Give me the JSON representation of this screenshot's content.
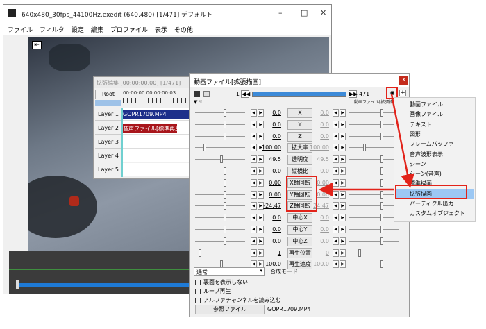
{
  "main": {
    "title": "640x480_30fps_44100Hz.exedit (640,480)  [1/471]  デフォルト",
    "menu": [
      "ファイル",
      "フィルタ",
      "設定",
      "編集",
      "プロファイル",
      "表示",
      "その他"
    ]
  },
  "timeline": {
    "title": "拡張編集 [00:00:00.00] [1/471]",
    "root": "Root",
    "ruler": "00:00:00.00   00:00:03.",
    "layers": [
      "Layer 1",
      "Layer 2",
      "Layer 3",
      "Layer 4",
      "Layer 5"
    ],
    "clip1": "GOPR1709.MP4",
    "clip2": "音声ファイル[標準再生]"
  },
  "dialog": {
    "title": "動画ファイル[拡張描画]",
    "close": "x",
    "frame_start": "1",
    "frame_end": "471",
    "type_label": "動画ファイル[拡張描画",
    "params": [
      {
        "label": "X",
        "value": "0.0",
        "value2": "0.0"
      },
      {
        "label": "Y",
        "value": "0.0",
        "value2": "0.0"
      },
      {
        "label": "Z",
        "value": "0.0",
        "value2": "0.0"
      },
      {
        "label": "拡大率",
        "value": "100.00",
        "value2": "100.00"
      },
      {
        "label": "透明度",
        "value": "49.5",
        "value2": "49.5"
      },
      {
        "label": "縦横比",
        "value": "0.0",
        "value2": "0.0"
      },
      {
        "label": "X軸回転",
        "value": "0.00",
        "value2": "0.00"
      },
      {
        "label": "Y軸回転",
        "value": "0.00",
        "value2": "0.00"
      },
      {
        "label": "Z軸回転",
        "value": "-24.47",
        "value2": "24.47"
      },
      {
        "label": "中心X",
        "value": "0.0",
        "value2": "0.0"
      },
      {
        "label": "中心Y",
        "value": "0.0",
        "value2": "0.0"
      },
      {
        "label": "中心Z",
        "value": "0.0",
        "value2": "0.0"
      },
      {
        "label": "再生位置",
        "value": "1",
        "value2": "0"
      },
      {
        "label": "再生速度",
        "value": "100.0",
        "value2": "100.0"
      }
    ],
    "blend_mode": "通常",
    "blend_label": "合成モード",
    "checkboxes": [
      "裏面を表示しない",
      "ループ再生",
      "アルファチャンネルを読み込む"
    ],
    "ref_button": "参照ファイル",
    "ref_file": "GOPR1709.MP4"
  },
  "context_menu": {
    "items": [
      "動画ファイル",
      "画像ファイル",
      "テキスト",
      "図形",
      "フレームバッファ",
      "音声波形表示",
      "シーン",
      "シーン(音声)",
      "標準描画",
      "拡張描画",
      "パーティクル出力",
      "カスタムオブジェクト"
    ],
    "selected_index": 9
  }
}
